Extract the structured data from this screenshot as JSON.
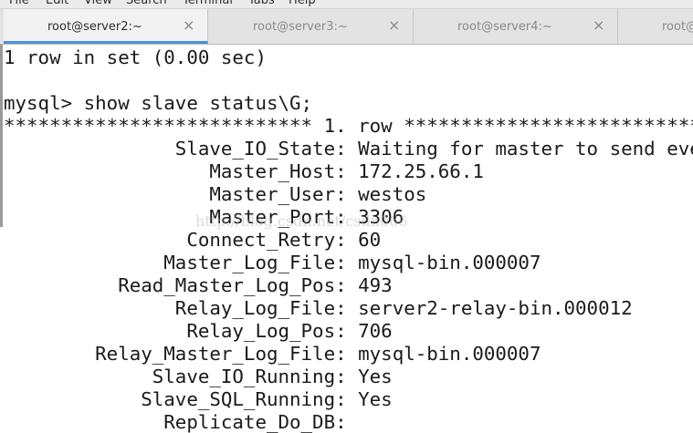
{
  "menubar": {
    "items": [
      "File",
      "Edit",
      "View",
      "Search",
      "Terminal",
      "Tabs",
      "Help"
    ]
  },
  "tabs": [
    {
      "label": "root@server2:~",
      "close": "×",
      "active": true
    },
    {
      "label": "root@server3:~",
      "close": "×",
      "active": false
    },
    {
      "label": "root@server4:~",
      "close": "×",
      "active": false
    },
    {
      "label": "root@",
      "close": "",
      "active": false
    }
  ],
  "terminal": {
    "lines": [
      "1 row in set (0.00 sec)",
      "",
      "mysql> show slave status\\G;",
      "*************************** 1. row ***************************",
      "               Slave_IO_State: Waiting for master to send event",
      "                  Master_Host: 172.25.66.1",
      "                  Master_User: westos",
      "                  Master_Port: 3306",
      "                Connect_Retry: 60",
      "              Master_Log_File: mysql-bin.000007",
      "          Read_Master_Log_Pos: 493",
      "               Relay_Log_File: server2-relay-bin.000012",
      "                Relay_Log_Pos: 706",
      "        Relay_Master_Log_File: mysql-bin.000007",
      "             Slave_IO_Running: Yes",
      "            Slave_SQL_Running: Yes",
      "              Replicate_Do_DB: "
    ]
  },
  "watermark": "http://blog.csdn.net/csdn066"
}
